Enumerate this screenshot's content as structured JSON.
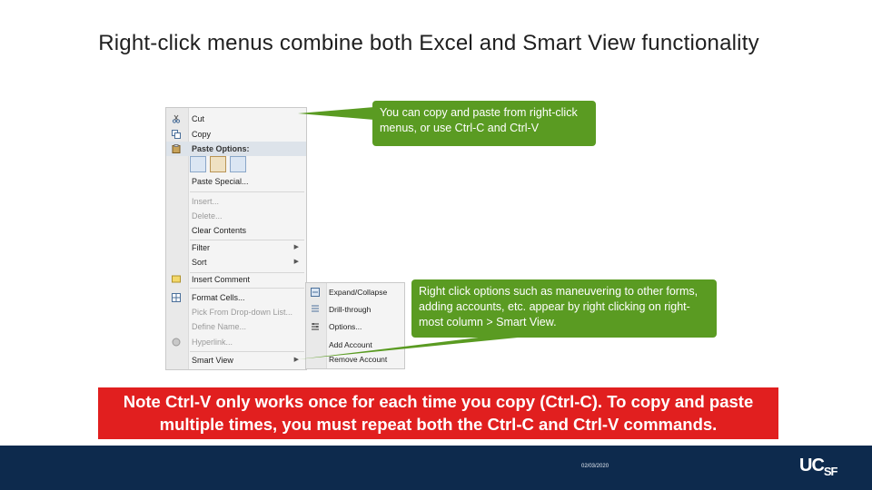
{
  "title": "Right-click menus combine both Excel and Smart View functionality",
  "context_menu": {
    "items": [
      {
        "label": "Cut",
        "icon": "scissors-icon"
      },
      {
        "label": "Copy",
        "icon": "copy-icon"
      },
      {
        "label": "Paste Options:",
        "icon": "clipboard-icon"
      },
      {
        "label": "Paste Special...",
        "icon": ""
      },
      {
        "label": "Insert...",
        "icon": ""
      },
      {
        "label": "Delete...",
        "icon": ""
      },
      {
        "label": "Clear Contents",
        "icon": ""
      },
      {
        "label": "Filter",
        "icon": ""
      },
      {
        "label": "Sort",
        "icon": ""
      },
      {
        "label": "Insert Comment",
        "icon": "comment-icon"
      },
      {
        "label": "Format Cells...",
        "icon": "format-cells-icon"
      },
      {
        "label": "Pick From Drop-down List...",
        "icon": ""
      },
      {
        "label": "Define Name...",
        "icon": ""
      },
      {
        "label": "Hyperlink...",
        "icon": "hyperlink-icon"
      },
      {
        "label": "Smart View",
        "icon": ""
      }
    ]
  },
  "submenu": {
    "items": [
      {
        "label": "Expand/Collapse",
        "icon": "expand-icon"
      },
      {
        "label": "Drill-through",
        "icon": "drill-icon"
      },
      {
        "label": "Options...",
        "icon": "options-icon"
      },
      {
        "label": "Add Account",
        "icon": ""
      },
      {
        "label": "Remove Account",
        "icon": ""
      }
    ]
  },
  "callouts": {
    "copy_paste": "You can copy and paste from right-click menus, or use Ctrl-C and Ctrl-V",
    "smart_view": "Right click options such as maneuvering to other forms, adding accounts, etc. appear by right clicking on right-most column > Smart View."
  },
  "note": "Note Ctrl-V only works once for each time you copy (Ctrl-C). To copy and paste multiple times, you must repeat both the Ctrl-C and Ctrl-V commands.",
  "footer": {
    "date": "02/03/2020",
    "logo_main": "UC",
    "logo_sub": "SF"
  },
  "colors": {
    "callout_green": "#5a9b22",
    "note_red": "#e11f1f",
    "footer_navy": "#0d2a4d"
  }
}
